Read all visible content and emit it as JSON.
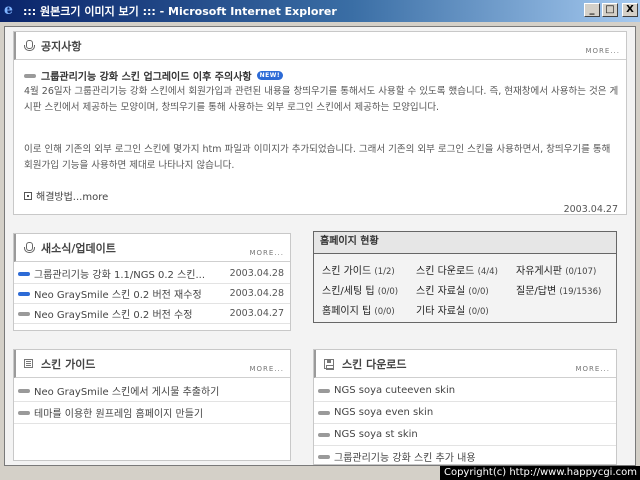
{
  "window": {
    "title": "::: 원본크기 이미지 보기 ::: - Microsoft Internet Explorer",
    "controls": {
      "minimize": "_",
      "maximize": "□",
      "close": "X"
    }
  },
  "notice": {
    "title": "공지사항",
    "more": "MORE...",
    "headline": "그룹관리기능 강화 스킨 업그레이드 이후 주의사항",
    "badge": "NEW!",
    "paragraph1": "4월 26일자 그룹관리기능 강화 스킨에서 회원가입과 관련된 내용을 창띄우기를 통해서도 사용할 수 있도록 했습니다. 즉, 현재창에서 사용하는 것은 게시판 스킨에서 제공하는 모양이며, 창띄우기를 통해 사용하는 외부 로그인 스킨에서 제공하는 모양입니다.",
    "paragraph2": "이로 인해 기존의 외부 로그인 스킨에 몇가지 htm 파일과 이미지가 추가되었습니다. 그래서 기존의 외부 로그인 스킨을 사용하면서, 창띄우기를 통해 회원가입 기능을 사용하면 제대로 나타나지 않습니다.",
    "solution": "해결방법...more",
    "date": "2003.04.27"
  },
  "news": {
    "title": "새소식/업데이트",
    "more": "MORE...",
    "items": [
      {
        "label": "그룹관리기능 강화 1.1/NGS 0.2 스킨...",
        "date": "2003.04.28"
      },
      {
        "label": "Neo GraySmile 스킨 0.2 버전 재수정",
        "date": "2003.04.28"
      },
      {
        "label": "Neo GraySmile 스킨 0.2 버전 수정",
        "date": "2003.04.27"
      }
    ]
  },
  "status": {
    "title": "홈페이지 현황",
    "rows": [
      [
        {
          "label": "스킨 가이드",
          "count": "(1/2)"
        },
        {
          "label": "스킨 다운로드",
          "count": "(4/4)"
        },
        {
          "label": "자유게시판",
          "count": "(0/107)"
        }
      ],
      [
        {
          "label": "스킨/세팅 팁",
          "count": "(0/0)"
        },
        {
          "label": "스킨 자료실",
          "count": "(0/0)"
        },
        {
          "label": "질문/답변",
          "count": "(19/1536)"
        }
      ],
      [
        {
          "label": "홈페이지 팁",
          "count": "(0/0)"
        },
        {
          "label": "기타 자료실",
          "count": "(0/0)"
        }
      ]
    ]
  },
  "guide": {
    "title": "스킨 가이드",
    "more": "MORE...",
    "items": [
      {
        "label": "Neo GraySmile 스킨에서 게시물 추출하기"
      },
      {
        "label": "테마를 이용한 원프레임 홈페이지 만들기"
      }
    ]
  },
  "download": {
    "title": "스킨 다운로드",
    "more": "MORE...",
    "items": [
      {
        "label": "NGS soya cuteeven skin"
      },
      {
        "label": "NGS soya even skin"
      },
      {
        "label": "NGS soya st skin"
      },
      {
        "label": "그룹관리기능 강화 스킨 추가 내용"
      }
    ]
  },
  "footer": {
    "copyright": "Copyright(c) http://www.happycgi.com"
  },
  "colors": {
    "titlebar": "#0a246a",
    "accent": "#2d6bd6",
    "bullet": "#9a9a9a"
  }
}
